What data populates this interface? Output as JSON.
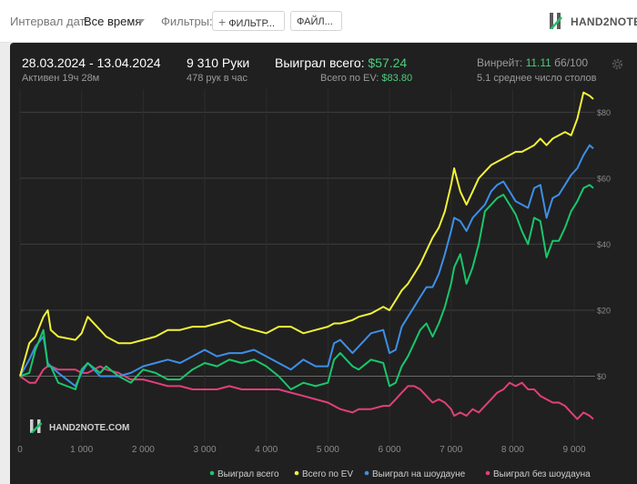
{
  "toolbar": {
    "date_interval_label": "Интервал дат:",
    "date_interval_value": "Все время",
    "filters_label": "Фильтры:",
    "filters_button": "ФИЛЬТР...",
    "files_button": "ФАЙЛ...",
    "brand_logo": "HAND2NOTE"
  },
  "stats": {
    "date_range": "28.03.2024 - 13.04.2024",
    "active_time": "Активен 19ч 28м",
    "hands": "9 310 Руки",
    "hands_per_hour": "478 рук в час",
    "won_total_label": "Выиграл всего:",
    "won_total_value": "$57.24",
    "ev_label": "Всего по EV:",
    "ev_value": "$83.80",
    "winrate_label": "Винрейт:",
    "winrate_value": "11.11",
    "winrate_unit": "б6/100",
    "avg_tables": "5.1 среднее число столов"
  },
  "colors": {
    "won": "#19c76b",
    "ev": "#f2f23a",
    "showdown": "#3d8fe8",
    "non_showdown": "#e0407a",
    "accent_green": "#4ccf7c"
  },
  "chart_data": {
    "type": "line",
    "watermark": "HAND2NOTE.COM",
    "x_ticks": [
      0,
      1000,
      2000,
      3000,
      4000,
      5000,
      6000,
      7000,
      8000,
      9000
    ],
    "x_tick_labels": [
      "0",
      "1 000",
      "2 000",
      "3 000",
      "4 000",
      "5 000",
      "6 000",
      "7 000",
      "8 000",
      "9 000"
    ],
    "y_ticks": [
      0,
      20,
      40,
      60,
      80
    ],
    "y_tick_labels": [
      "$0",
      "$20",
      "$40",
      "$60",
      "$80"
    ],
    "xlim": [
      0,
      9310
    ],
    "ylim": [
      -20,
      87
    ],
    "grid": true,
    "legend_position": "bottom",
    "series": [
      {
        "name": "Выиграл всего",
        "color": "#19c76b",
        "x": [
          0,
          150,
          250,
          380,
          450,
          500,
          620,
          900,
          1000,
          1100,
          1300,
          1400,
          1600,
          1800,
          2000,
          2200,
          2400,
          2600,
          2800,
          3000,
          3200,
          3400,
          3600,
          3800,
          4000,
          4200,
          4400,
          4600,
          4800,
          5000,
          5100,
          5200,
          5400,
          5500,
          5700,
          5900,
          6000,
          6100,
          6200,
          6300,
          6400,
          6500,
          6600,
          6700,
          6800,
          6900,
          7000,
          7050,
          7150,
          7250,
          7350,
          7450,
          7550,
          7650,
          7750,
          7850,
          7950,
          8050,
          8150,
          8250,
          8350,
          8450,
          8550,
          8650,
          8750,
          8850,
          8950,
          9050,
          9150,
          9250,
          9310
        ],
        "y": [
          0,
          1,
          8,
          14,
          3,
          3,
          -2,
          -4,
          2,
          4,
          1,
          3,
          0,
          -2,
          2,
          1,
          -1,
          -1,
          2,
          4,
          3,
          5,
          4,
          5,
          3,
          0,
          -4,
          -2,
          -3,
          -2,
          5,
          7,
          3,
          2,
          5,
          4,
          -3,
          -2,
          3,
          6,
          10,
          14,
          16,
          12,
          16,
          21,
          28,
          33,
          37,
          28,
          33,
          40,
          50,
          52,
          54,
          55,
          52,
          49,
          44,
          40,
          48,
          47,
          36,
          41,
          41,
          45,
          50,
          53,
          57,
          58,
          57
        ]
      },
      {
        "name": "Всего по EV",
        "color": "#f2f23a",
        "x": [
          0,
          150,
          250,
          380,
          450,
          500,
          620,
          900,
          1000,
          1100,
          1300,
          1400,
          1600,
          1800,
          2000,
          2200,
          2400,
          2600,
          2800,
          3000,
          3200,
          3400,
          3600,
          3800,
          4000,
          4200,
          4400,
          4600,
          4800,
          5000,
          5100,
          5200,
          5400,
          5500,
          5700,
          5900,
          6000,
          6100,
          6200,
          6300,
          6400,
          6500,
          6600,
          6700,
          6800,
          6900,
          7000,
          7050,
          7150,
          7250,
          7350,
          7450,
          7550,
          7650,
          7750,
          7850,
          7950,
          8050,
          8150,
          8250,
          8350,
          8450,
          8550,
          8650,
          8750,
          8850,
          8950,
          9050,
          9150,
          9250,
          9310
        ],
        "y": [
          0,
          10,
          12,
          18,
          20,
          14,
          12,
          11,
          13,
          18,
          14,
          12,
          10,
          10,
          11,
          12,
          14,
          14,
          15,
          15,
          16,
          17,
          15,
          14,
          13,
          15,
          15,
          13,
          14,
          15,
          16,
          16,
          17,
          18,
          19,
          21,
          20,
          23,
          26,
          28,
          31,
          34,
          38,
          42,
          45,
          50,
          58,
          63,
          56,
          52,
          56,
          60,
          62,
          64,
          65,
          66,
          67,
          68,
          68,
          69,
          70,
          72,
          70,
          72,
          73,
          74,
          73,
          78,
          86,
          85,
          84
        ]
      },
      {
        "name": "Выиграл на шоудауне",
        "color": "#3d8fe8",
        "x": [
          0,
          150,
          250,
          380,
          450,
          500,
          620,
          900,
          1000,
          1100,
          1300,
          1400,
          1600,
          1800,
          2000,
          2200,
          2400,
          2600,
          2800,
          3000,
          3200,
          3400,
          3600,
          3800,
          4000,
          4200,
          4400,
          4600,
          4800,
          5000,
          5100,
          5200,
          5400,
          5500,
          5700,
          5900,
          6000,
          6100,
          6200,
          6300,
          6400,
          6500,
          6600,
          6700,
          6800,
          6900,
          7000,
          7050,
          7150,
          7250,
          7350,
          7450,
          7550,
          7650,
          7750,
          7850,
          7950,
          8050,
          8150,
          8250,
          8350,
          8450,
          8550,
          8650,
          8750,
          8850,
          8950,
          9050,
          9150,
          9250,
          9310
        ],
        "y": [
          0,
          5,
          9,
          12,
          4,
          3,
          1,
          -3,
          1,
          4,
          0,
          0,
          0,
          1,
          3,
          4,
          5,
          4,
          6,
          8,
          6,
          7,
          7,
          8,
          6,
          4,
          2,
          5,
          3,
          3,
          10,
          11,
          7,
          9,
          13,
          14,
          7,
          8,
          15,
          18,
          21,
          24,
          27,
          27,
          31,
          37,
          44,
          48,
          47,
          44,
          48,
          50,
          52,
          56,
          58,
          59,
          56,
          53,
          52,
          51,
          57,
          58,
          48,
          54,
          55,
          58,
          61,
          63,
          67,
          70,
          69
        ]
      },
      {
        "name": "Выиграл без шоудауна",
        "color": "#e0407a",
        "x": [
          0,
          150,
          250,
          380,
          450,
          500,
          620,
          900,
          1000,
          1100,
          1300,
          1400,
          1600,
          1800,
          2000,
          2200,
          2400,
          2600,
          2800,
          3000,
          3200,
          3400,
          3600,
          3800,
          4000,
          4200,
          4400,
          4600,
          4800,
          5000,
          5100,
          5200,
          5400,
          5500,
          5700,
          5900,
          6000,
          6100,
          6200,
          6300,
          6400,
          6500,
          6600,
          6700,
          6800,
          6900,
          7000,
          7050,
          7150,
          7250,
          7350,
          7450,
          7550,
          7650,
          7750,
          7850,
          7950,
          8050,
          8150,
          8250,
          8350,
          8450,
          8550,
          8650,
          8750,
          8850,
          8950,
          9050,
          9150,
          9250,
          9310
        ],
        "y": [
          0,
          -2,
          -2,
          2,
          3,
          3,
          2,
          2,
          1,
          1,
          3,
          2,
          1,
          -1,
          -1,
          -2,
          -3,
          -3,
          -4,
          -4,
          -4,
          -3,
          -4,
          -4,
          -4,
          -4,
          -5,
          -6,
          -7,
          -8,
          -9,
          -10,
          -11,
          -10,
          -10,
          -9,
          -9,
          -7,
          -5,
          -3,
          -3,
          -4,
          -6,
          -8,
          -7,
          -8,
          -10,
          -12,
          -11,
          -12,
          -10,
          -11,
          -9,
          -7,
          -5,
          -4,
          -2,
          -3,
          -2,
          -4,
          -4,
          -6,
          -7,
          -8,
          -8,
          -9,
          -11,
          -13,
          -11,
          -12,
          -13
        ]
      }
    ]
  }
}
